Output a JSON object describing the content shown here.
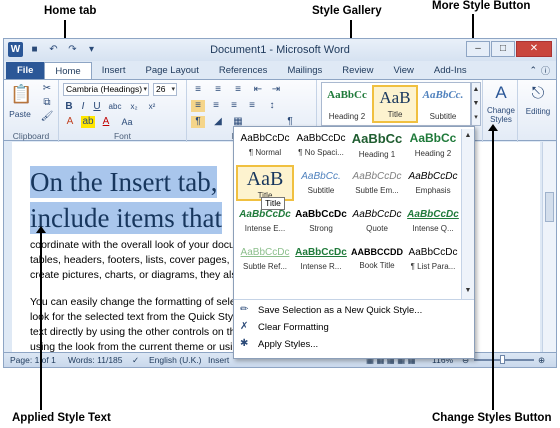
{
  "callouts": {
    "home_tab": "Home  tab",
    "style_gallery": "Style Gallery",
    "more_style_button": "More Style Button",
    "applied_style_text": "Applied Style Text",
    "change_styles_button": "Change Styles Button"
  },
  "window": {
    "title": "Document1 - Microsoft Word",
    "app_icon": "W",
    "controls": [
      "–",
      "□",
      "✕"
    ]
  },
  "tabs": [
    "File",
    "Home",
    "Insert",
    "Page Layout",
    "References",
    "Mailings",
    "Review",
    "View",
    "Add-Ins"
  ],
  "ribbon": {
    "clipboard": {
      "label": "Clipboard",
      "paste": "Paste"
    },
    "font": {
      "label": "Font",
      "name": "Cambria (Headings)",
      "size": "26"
    },
    "paragraph": {
      "label": "Paragraph"
    },
    "styles": {
      "gallery": [
        {
          "sample": "AaBbCc",
          "caption": "Heading 2"
        },
        {
          "sample": "AaB",
          "caption": "Title"
        },
        {
          "sample": "AaBbCc.",
          "caption": "Subtitle"
        }
      ],
      "change_styles": "Change Styles",
      "editing": "Editing"
    }
  },
  "document": {
    "heading_lines": [
      "On the Insert tab,",
      "include items that"
    ],
    "paragraphs": [
      "coordinate with the overall look of your docu",
      "tables, headers, footers, lists, cover pages, an",
      "create pictures, charts, or diagrams, they also",
      "",
      "You can easily change the formatting of select",
      "look for the selected text from the Quick Style",
      "text directly by using the other controls on th",
      "using the look from the current theme or usin"
    ]
  },
  "styles_dropdown": {
    "cells": [
      {
        "sample": "AaBbCcDc",
        "caption": "¶ Normal"
      },
      {
        "sample": "AaBbCcDc",
        "caption": "¶ No Spaci..."
      },
      {
        "sample": "AaBbCc",
        "caption": "Heading 1"
      },
      {
        "sample": "AaBbCc",
        "caption": "Heading 2"
      },
      {
        "sample": "AaB",
        "caption": "Title"
      },
      {
        "sample": "AaBbCc.",
        "caption": "Subtitle"
      },
      {
        "sample": "AaBbCcDc",
        "caption": "Subtle Em..."
      },
      {
        "sample": "AaBbCcDc",
        "caption": "Emphasis"
      },
      {
        "sample": "AaBbCcDc",
        "caption": "Intense E..."
      },
      {
        "sample": "AaBbCcDc",
        "caption": "Strong"
      },
      {
        "sample": "AaBbCcDc",
        "caption": "Quote"
      },
      {
        "sample": "AaBbCcDc",
        "caption": "Intense Q..."
      },
      {
        "sample": "AaBbCcDc",
        "caption": "Subtle Ref..."
      },
      {
        "sample": "AaBbCcDc",
        "caption": "Intense R..."
      },
      {
        "sample": "AABBCCDD",
        "caption": "Book Title"
      },
      {
        "sample": "AaBbCcDc",
        "caption": "¶ List Para..."
      }
    ],
    "tooltip": "Title",
    "actions": [
      {
        "label": "Save Selection as a New Quick Style...",
        "icon": "save-style-icon"
      },
      {
        "label": "Clear Formatting",
        "icon": "clear-formatting-icon"
      },
      {
        "label": "Apply Styles...",
        "icon": "apply-styles-icon"
      }
    ]
  },
  "status": {
    "page": "Page: 1 of 1",
    "words": "Words: 11/185",
    "language": "English (U.K.)",
    "mode": "Insert",
    "zoom": "116%"
  },
  "colors": {
    "file_tab": "#2b5797",
    "selection": "#a9c6ec",
    "heading_text": "#17365d",
    "gallery_highlight": "#f0c040"
  }
}
